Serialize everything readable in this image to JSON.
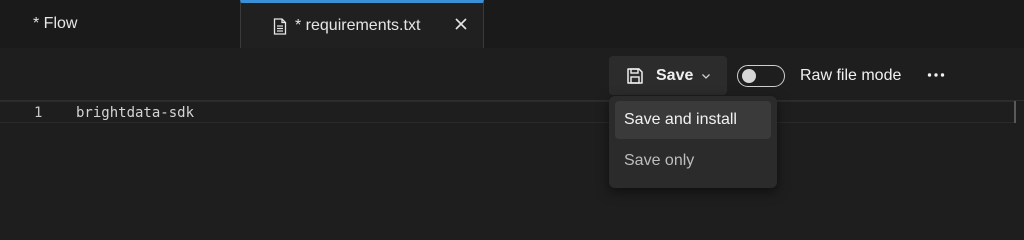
{
  "tabs": [
    {
      "label": "* Flow",
      "active": false
    },
    {
      "label": "* requirements.txt",
      "active": true
    }
  ],
  "toolbar": {
    "save_label": "Save",
    "raw_mode_label": "Raw file mode",
    "raw_mode_on": false,
    "more_label": "···"
  },
  "dropdown": {
    "items": [
      {
        "label": "Save and install",
        "highlighted": true
      },
      {
        "label": "Save only",
        "highlighted": false
      }
    ]
  },
  "editor": {
    "lines": [
      {
        "number": "1",
        "text": "brightdata-sdk"
      }
    ]
  },
  "colors": {
    "accent": "#3a8fd6",
    "background": "#1e1e1e",
    "tabbar": "#1a1a1a"
  }
}
